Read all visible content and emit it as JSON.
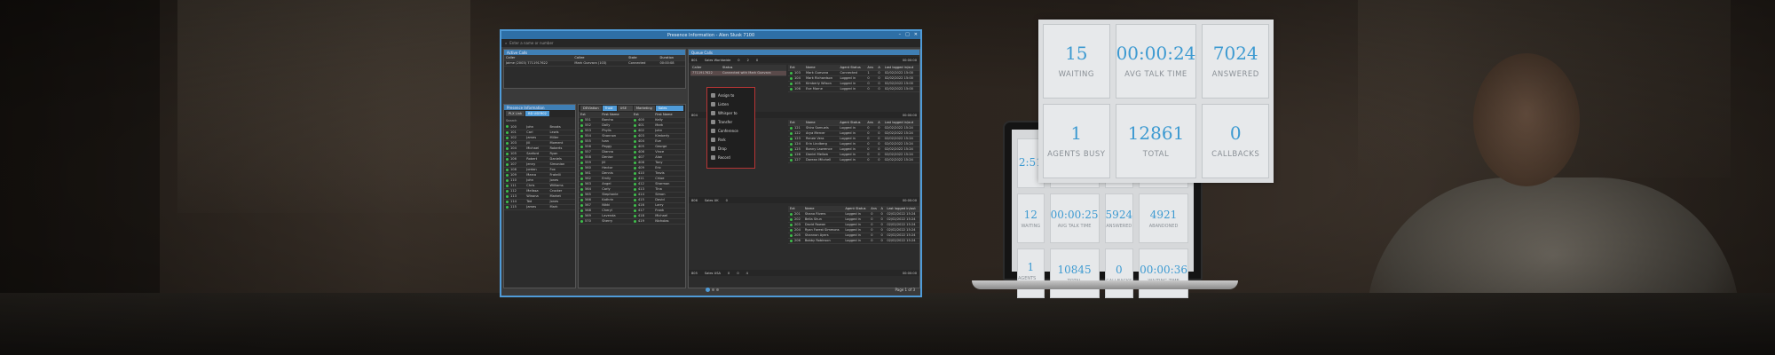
{
  "dashboard": {
    "tiles": [
      {
        "value": "15",
        "label": "WAITING"
      },
      {
        "value": "00:00:24",
        "label": "AVG TALK TIME"
      },
      {
        "value": "7024",
        "label": "ANSWERED"
      },
      {
        "value": "1",
        "label": "AGENTS BUSY"
      },
      {
        "value": "12861",
        "label": "TOTAL"
      },
      {
        "value": "0",
        "label": "CALLBACKS"
      }
    ]
  },
  "laptop": {
    "tiles": [
      {
        "value": "2:51",
        "label": ""
      },
      {
        "value": "",
        "label": ""
      },
      {
        "value": "",
        "label": ""
      },
      {
        "value": "",
        "label": ""
      },
      {
        "value": "12",
        "label": "WAITING"
      },
      {
        "value": "00:00:25",
        "label": "AVG TALK TIME"
      },
      {
        "value": "5924",
        "label": "ANSWERED"
      },
      {
        "value": "4921",
        "label": "ABANDONED"
      },
      {
        "value": "1",
        "label": "AGENTS BUSY"
      },
      {
        "value": "10845",
        "label": "TOTAL"
      },
      {
        "value": "0",
        "label": "CALLBACKS"
      },
      {
        "value": "00:00:36",
        "label": "WAITING TIME"
      }
    ]
  },
  "app": {
    "title": "Presence Information - Alen Slusk 7100",
    "search_placeholder": "Enter a name or number",
    "active_calls": {
      "header": "Active Calls",
      "columns": [
        "Caller",
        "Callee",
        "State",
        "Duration"
      ],
      "rows": [
        [
          "Jaime (2003) 7711917622",
          "Mark Guevara (103)",
          "Connected",
          "00:00:08"
        ]
      ]
    },
    "queue_header": "Queue Calls",
    "queue": {
      "name": "Sales Worldwide",
      "columns": [
        "Caller",
        "Status"
      ],
      "rows": [
        [
          "7711917622",
          "Connected with Mark Guevara"
        ]
      ]
    },
    "presence": {
      "header": "Presence Information",
      "tabs": [
        "PLX Link",
        "BD USER02"
      ],
      "search_label": "Search",
      "rows": [
        [
          "100",
          "John",
          "Brooks"
        ],
        [
          "101",
          "Carl",
          "Lewis"
        ],
        [
          "102",
          "James",
          "Miller"
        ],
        [
          "103",
          "Jill",
          "Moment"
        ],
        [
          "104",
          "Michael",
          "Roberts"
        ],
        [
          "105",
          "Sanford",
          "Ryan"
        ],
        [
          "106",
          "Robert",
          "Daniels"
        ],
        [
          "107",
          "Jenny",
          "Simonian"
        ],
        [
          "108",
          "Jordan",
          "Fox"
        ],
        [
          "109",
          "Marco",
          "Fratelli"
        ],
        [
          "110",
          "John",
          "Jones"
        ],
        [
          "111",
          "Chris",
          "Williams"
        ],
        [
          "112",
          "Melissa",
          "Crocker"
        ],
        [
          "113",
          "Winona",
          "Market"
        ],
        [
          "114",
          "Ted",
          "Jones"
        ],
        [
          "115",
          "James",
          "Mark"
        ]
      ]
    },
    "ext_tabs": [
      "DEVIation",
      "Trust 1L",
      "USE KCA",
      "Marketing",
      "Sales Opportunities"
    ],
    "ext_columns": [
      "Ext",
      "First Name"
    ],
    "ext_rows": [
      [
        "551",
        "Barcha"
      ],
      [
        "552",
        "Dolly"
      ],
      [
        "553",
        "Phylis"
      ],
      [
        "554",
        "Shannon"
      ],
      [
        "555",
        "Ivan"
      ],
      [
        "556",
        "Peggy"
      ],
      [
        "557",
        "Dianna"
      ],
      [
        "558",
        "Denise"
      ],
      [
        "559",
        "Jill"
      ],
      [
        "560",
        "Hector"
      ],
      [
        "561",
        "Dennis"
      ],
      [
        "562",
        "Emily"
      ],
      [
        "563",
        "Angel"
      ],
      [
        "564",
        "Carly"
      ],
      [
        "565",
        "Stephanie"
      ],
      [
        "566",
        "Kathrin"
      ],
      [
        "567",
        "Nikki"
      ],
      [
        "568",
        "Cheryl"
      ],
      [
        "569",
        "Lavenda"
      ],
      [
        "570",
        "Sherry"
      ]
    ],
    "ext2_rows": [
      [
        "400",
        "Kelly"
      ],
      [
        "401",
        "Mark"
      ],
      [
        "402",
        "John"
      ],
      [
        "403",
        "Kimberly"
      ],
      [
        "404",
        "Eve"
      ],
      [
        "405",
        "George"
      ],
      [
        "406",
        "Vince"
      ],
      [
        "407",
        "Alan"
      ],
      [
        "408",
        "Tony"
      ],
      [
        "409",
        "Eric"
      ],
      [
        "410",
        "Travis"
      ],
      [
        "411",
        "Chloe"
      ],
      [
        "412",
        "Sharmon"
      ],
      [
        "413",
        "Tina"
      ],
      [
        "414",
        "Simon"
      ],
      [
        "415",
        "David"
      ],
      [
        "416",
        "Larry"
      ],
      [
        "417",
        "Frank"
      ],
      [
        "418",
        "Michael"
      ],
      [
        "419",
        "Nicholas"
      ]
    ],
    "agents_columns": [
      "Ext",
      "Name",
      "Agent Status",
      "Ans",
      "A",
      "Last logged in/out"
    ],
    "agents1": [
      [
        "103",
        "Mark Guevara",
        "Connected",
        "1",
        "0",
        "02/02/2022 15:00"
      ],
      [
        "104",
        "Mark Richardson",
        "Logged in",
        "0",
        "0",
        "02/02/2022 15:00"
      ],
      [
        "105",
        "Kimberly Wilson",
        "Logged in",
        "0",
        "0",
        "02/02/2022 15:00"
      ],
      [
        "106",
        "Eve Morne",
        "Logged in",
        "0",
        "0",
        "02/02/2022 15:00"
      ]
    ],
    "agents2": [
      [
        "121",
        "Shira Samuels",
        "Logged in",
        "0",
        "0",
        "02/02/2022 15:24"
      ],
      [
        "122",
        "Arya Mercer",
        "Logged in",
        "0",
        "0",
        "02/02/2022 15:24"
      ],
      [
        "123",
        "Renee Vera",
        "Logged in",
        "0",
        "0",
        "02/02/2022 15:24"
      ],
      [
        "124",
        "Erin Lindberg",
        "Logged in",
        "0",
        "0",
        "02/02/2022 15:24"
      ],
      [
        "125",
        "Bonny Lawrence",
        "Logged in",
        "0",
        "0",
        "02/02/2022 15:24"
      ],
      [
        "126",
        "Daniel Mellow",
        "Logged in",
        "0",
        "0",
        "02/02/2022 15:24"
      ],
      [
        "127",
        "Dorean Mitchell",
        "Logged in",
        "0",
        "0",
        "02/02/2022 15:24"
      ]
    ],
    "agents3": [
      [
        "201",
        "Shana Rivers",
        "Logged in",
        "0",
        "0",
        "02/02/2022 15:24"
      ],
      [
        "202",
        "Bella Shun",
        "Logged in",
        "0",
        "0",
        "02/02/2022 15:24"
      ],
      [
        "203",
        "David Rowan",
        "Logged in",
        "0",
        "0",
        "02/02/2022 15:24"
      ],
      [
        "204",
        "Ryan Forest Simmons",
        "Logged in",
        "0",
        "0",
        "02/02/2022 15:24"
      ],
      [
        "205",
        "Shannon Ayers",
        "Logged in",
        "0",
        "0",
        "02/02/2022 15:24"
      ],
      [
        "206",
        "Bobby Robinson",
        "Logged in",
        "0",
        "0",
        "02/02/2022 15:24"
      ]
    ],
    "queue_rows": [
      {
        "ext": "801",
        "name": "Sales Worldwide",
        "a": "0",
        "b": "2",
        "c": "0",
        "time": "00:00:00"
      },
      {
        "ext": "804",
        "name": "",
        "a": "0",
        "b": "2",
        "c": "",
        "time": "00:00:00"
      },
      {
        "ext": "806",
        "name": "Sales UK",
        "a": "0",
        "b": "",
        "c": "",
        "time": "00:00:00"
      },
      {
        "ext": "805",
        "name": "Sales USA",
        "a": "0",
        "b": "0",
        "c": "4",
        "time": "00:00:00"
      }
    ],
    "context_menu": [
      "Assign to",
      "Listen",
      "Whisper to",
      "Transfer",
      "Conference",
      "Park",
      "Drop",
      "Record"
    ],
    "pagination": "Page 1 of 3",
    "status_colors": {
      "logged_in": "#3ec04b",
      "accent": "#4f9bd8",
      "menu_border": "#b63535",
      "kpi_value": "#3d9ad1"
    }
  }
}
